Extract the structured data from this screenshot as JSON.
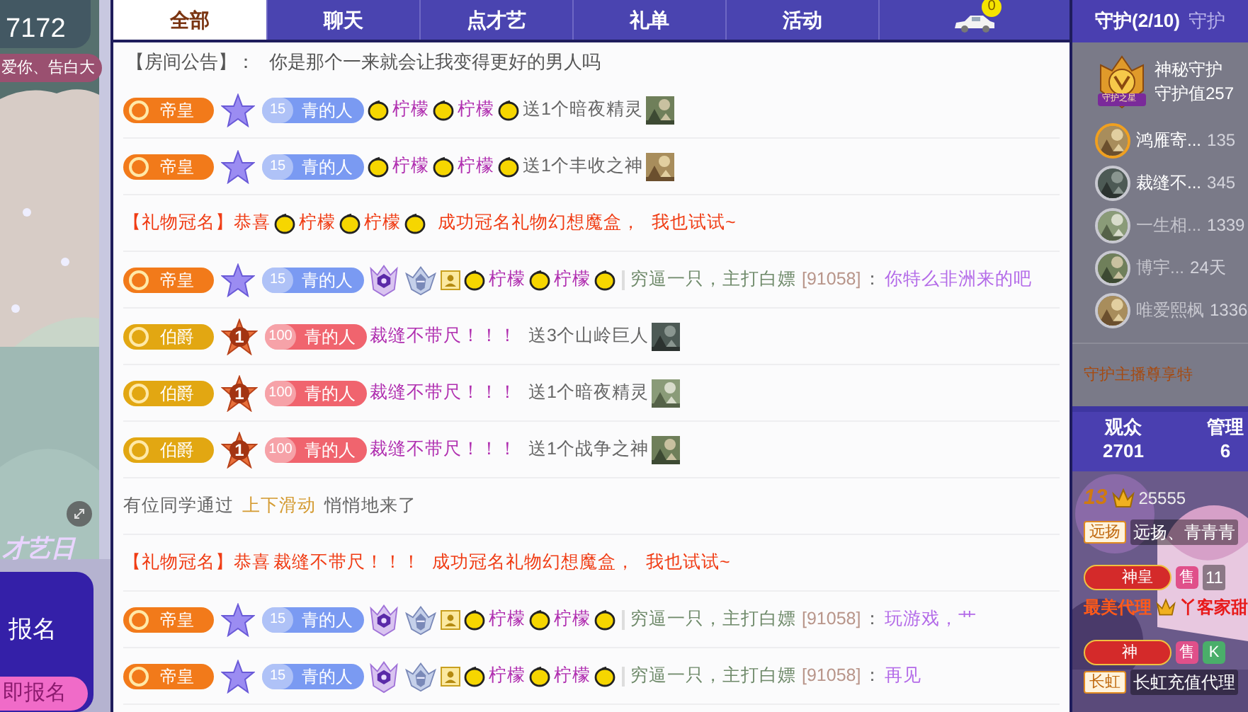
{
  "video": {
    "viewer_count": "7172",
    "banner": "爱你、告白大",
    "promo": {
      "title": "才艺日",
      "text": "报名",
      "button": "即报名"
    }
  },
  "chat": {
    "tabs": [
      {
        "label": "全部",
        "selected": true
      },
      {
        "label": "聊天",
        "selected": false
      },
      {
        "label": "点才艺",
        "selected": false
      },
      {
        "label": "礼单",
        "selected": false
      },
      {
        "label": "活动",
        "selected": false
      }
    ],
    "car_badge": "0",
    "messages": [
      {
        "kind": "announce",
        "label": "【房间公告】：",
        "text": "你是那个一来就会让我变得更好的男人吗"
      },
      {
        "kind": "gift",
        "noble": {
          "kind": "emperor",
          "label": "帝皇"
        },
        "medal": {
          "kind": "star"
        },
        "fan": {
          "color": "#7a9af2",
          "level": "15",
          "name": "青的人"
        },
        "name_parts": [
          "柠檬",
          "柠檬"
        ],
        "text": "送1个暗夜精灵",
        "gift": {
          "kind": "picture"
        }
      },
      {
        "kind": "gift",
        "noble": {
          "kind": "emperor",
          "label": "帝皇"
        },
        "medal": {
          "kind": "star"
        },
        "fan": {
          "color": "#7a9af2",
          "level": "15",
          "name": "青的人"
        },
        "name_parts": [
          "柠檬",
          "柠檬"
        ],
        "text": "送1个丰收之神",
        "gift": {
          "kind": "picture"
        }
      },
      {
        "kind": "naming",
        "prefix": "【礼物冠名】恭喜",
        "name_parts": [
          "柠檬",
          "柠檬"
        ],
        "text": "成功冠名礼物幻想魔盒，",
        "link": "我也试试~"
      },
      {
        "kind": "chat",
        "noble": {
          "kind": "emperor",
          "label": "帝皇"
        },
        "medal": {
          "kind": "star"
        },
        "fan": {
          "color": "#7a9af2",
          "level": "15",
          "name": "青的人"
        },
        "honors": true,
        "name_parts": [
          "柠檬",
          "柠檬"
        ],
        "sender": "穷逼一只，主打白嫖",
        "sender_id": "[91058]",
        "colon": "：",
        "text": "你特么非洲来的吧"
      },
      {
        "kind": "gift",
        "noble": {
          "kind": "earl",
          "label": "伯爵"
        },
        "medal": {
          "kind": "rank",
          "label": "1"
        },
        "fan": {
          "color": "#f0646e",
          "level": "100",
          "name": "青的人"
        },
        "name": "裁缝不带尺！！！",
        "text": "送3个山岭巨人",
        "gift": {
          "kind": "picture"
        }
      },
      {
        "kind": "gift",
        "noble": {
          "kind": "earl",
          "label": "伯爵"
        },
        "medal": {
          "kind": "rank",
          "label": "1"
        },
        "fan": {
          "color": "#f0646e",
          "level": "100",
          "name": "青的人"
        },
        "name": "裁缝不带尺！！！",
        "text": "送1个暗夜精灵",
        "gift": {
          "kind": "picture"
        }
      },
      {
        "kind": "gift",
        "noble": {
          "kind": "earl",
          "label": "伯爵"
        },
        "medal": {
          "kind": "rank",
          "label": "1"
        },
        "fan": {
          "color": "#f0646e",
          "level": "100",
          "name": "青的人"
        },
        "name": "裁缝不带尺！！！",
        "text": "送1个战争之神",
        "gift": {
          "kind": "picture"
        }
      },
      {
        "kind": "system",
        "before": "有位同学通过",
        "highlight": "上下滑动",
        "after": "悄悄地来了"
      },
      {
        "kind": "naming",
        "prefix": "【礼物冠名】恭喜",
        "name": "裁缝不带尺！！！",
        "text": "成功冠名礼物幻想魔盒，",
        "link": "我也试试~"
      },
      {
        "kind": "chat",
        "noble": {
          "kind": "emperor",
          "label": "帝皇"
        },
        "medal": {
          "kind": "star"
        },
        "fan": {
          "color": "#7a9af2",
          "level": "15",
          "name": "青的人"
        },
        "honors": true,
        "name_parts": [
          "柠檬",
          "柠檬"
        ],
        "sender": "穷逼一只，主打白嫖",
        "sender_id": "[91058]",
        "colon": "：",
        "text": "玩游戏，艹"
      },
      {
        "kind": "chat",
        "noble": {
          "kind": "emperor",
          "label": "帝皇"
        },
        "medal": {
          "kind": "star"
        },
        "fan": {
          "color": "#7a9af2",
          "level": "15",
          "name": "青的人"
        },
        "honors": true,
        "name_parts": [
          "柠檬",
          "柠檬"
        ],
        "sender": "穷逼一只，主打白嫖",
        "sender_id": "[91058]",
        "colon": "：",
        "text": "再见"
      }
    ]
  },
  "side": {
    "tabs": [
      {
        "label": "守护(2/10)",
        "selected": true
      },
      {
        "label": "守护",
        "selected": false
      }
    ],
    "top_guard": {
      "emblem_label": "守护之星",
      "name": "神秘守护",
      "value": "守护值257"
    },
    "guards": [
      {
        "name": "鸿雁寄...",
        "days": "135",
        "online": true,
        "highlighted": true
      },
      {
        "name": "裁缝不...",
        "days": "345",
        "online": true,
        "highlighted": false
      },
      {
        "name": "一生相...",
        "days": "1339",
        "online": false,
        "highlighted": false
      },
      {
        "name": "博宇...",
        "days": "24天",
        "online": false,
        "highlighted": false
      },
      {
        "name": "唯爱熙枫",
        "days": "1336",
        "online": false,
        "highlighted": false
      }
    ],
    "privilege": "守护主播尊享特",
    "stats": [
      {
        "label": "观众",
        "value": "2701"
      },
      {
        "label": "管理",
        "value": "6"
      }
    ],
    "feed": [
      {
        "level": "13",
        "score": "25555",
        "tag": "远扬",
        "text": "远扬、青青青"
      },
      {
        "noble": "神皇",
        "labels": [
          {
            "text": "售",
            "color": "#e0508a"
          }
        ],
        "count": "11",
        "title": "最美代理",
        "text": "丫客家甜"
      },
      {
        "noble": "神",
        "labels": [
          {
            "text": "售",
            "color": "#e0508a"
          },
          {
            "text": "K",
            "color": "#4aae6a"
          }
        ],
        "tag": "长虹",
        "text": "长虹充值代理"
      }
    ]
  }
}
